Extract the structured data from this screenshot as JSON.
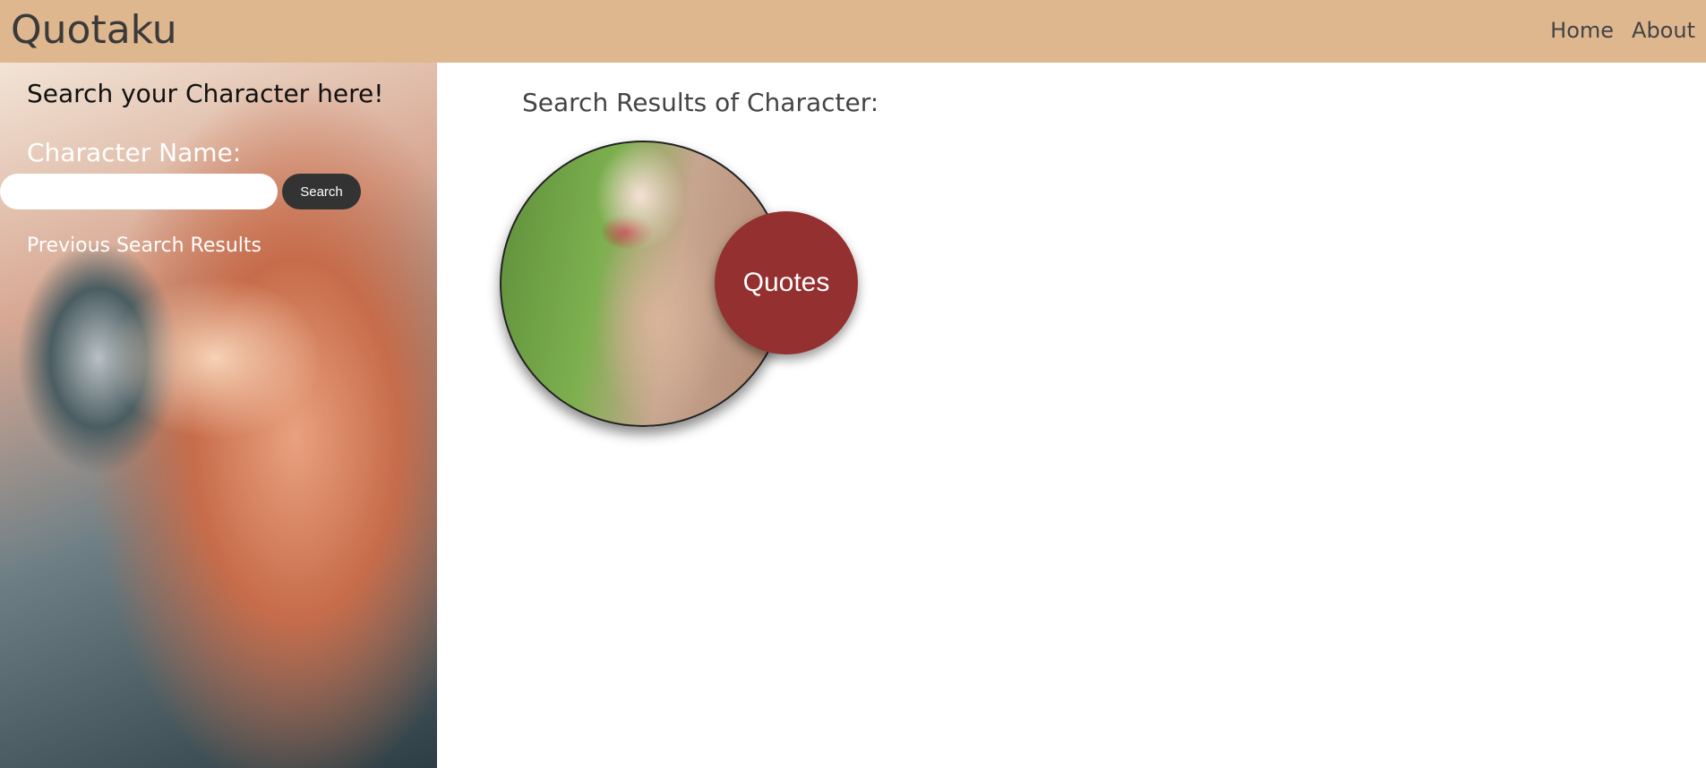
{
  "header": {
    "brand": "Quotaku",
    "nav": [
      "Home",
      "About"
    ]
  },
  "sidebar": {
    "title": "Search your Character here!",
    "label": "Character Name:",
    "input_value": "",
    "search_label": "Search",
    "previous": "Previous Search Results"
  },
  "main": {
    "title": "Search Results of Character:",
    "quotes_label": "Quotes"
  },
  "colors": {
    "header": "#deb78f",
    "quotes": "#943030",
    "button": "#333333"
  }
}
